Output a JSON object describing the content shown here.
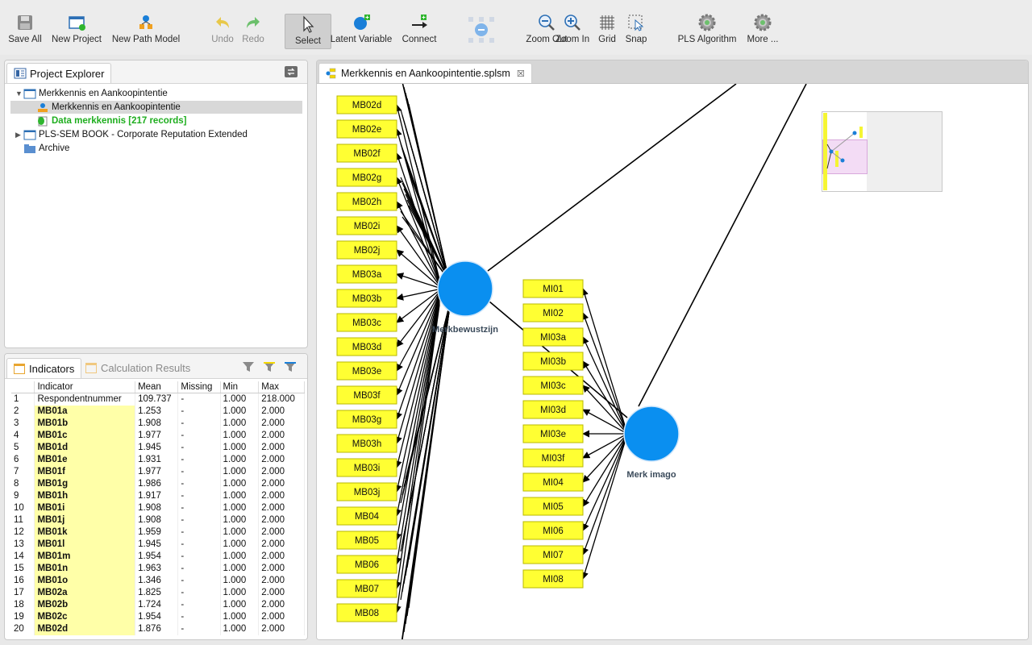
{
  "toolbar": [
    {
      "label": "Save All",
      "icon": "save-icon",
      "state": "normal"
    },
    {
      "label": "New Project",
      "icon": "new-project-icon",
      "state": "normal"
    },
    {
      "label": "New Path Model",
      "icon": "new-path-model-icon",
      "state": "normal"
    },
    {
      "label": "Undo",
      "icon": "undo-icon",
      "state": "disabled"
    },
    {
      "label": "Redo",
      "icon": "redo-icon",
      "state": "disabled"
    },
    {
      "label": "Select",
      "icon": "select-pointer-icon",
      "state": "active"
    },
    {
      "label": "Latent Variable",
      "icon": "latent-variable-icon",
      "state": "normal"
    },
    {
      "label": "Connect",
      "icon": "connect-arrow-icon",
      "state": "normal"
    },
    {
      "label": "Zoom Out",
      "icon": "zoom-out-icon",
      "state": "normal"
    },
    {
      "label": "Zoom In",
      "icon": "zoom-in-icon",
      "state": "normal"
    },
    {
      "label": "Grid",
      "icon": "grid-icon",
      "state": "normal"
    },
    {
      "label": "Snap",
      "icon": "snap-icon",
      "state": "normal"
    },
    {
      "label": "PLS Algorithm",
      "icon": "gear-icon",
      "state": "normal"
    },
    {
      "label": "More ...",
      "icon": "gear-icon",
      "state": "normal"
    }
  ],
  "explorer": {
    "title": "Project Explorer",
    "items": [
      {
        "label": "Merkkennis en Aankoopintentie",
        "level": 0,
        "expanded": true,
        "icon": "project-window-icon"
      },
      {
        "label": "Merkkennis en Aankoopintentie",
        "level": 1,
        "icon": "path-model-icon",
        "selected": true
      },
      {
        "label": "Data merkkennis [217 records]",
        "level": 1,
        "icon": "data-file-icon",
        "green": true
      },
      {
        "label": "PLS-SEM BOOK - Corporate Reputation Extended",
        "level": 0,
        "expanded": false,
        "icon": "project-window-icon"
      },
      {
        "label": "Archive",
        "level": 0,
        "icon": "archive-folder-icon"
      }
    ]
  },
  "indicators_panel": {
    "tabs": [
      "Indicators",
      "Calculation Results"
    ],
    "columns": [
      "",
      "Indicator",
      "Mean",
      "Missing",
      "Min",
      "Max"
    ],
    "rows": [
      [
        "1",
        "Respondentnummer",
        "109.737",
        "-",
        "1.000",
        "218.000"
      ],
      [
        "2",
        "MB01a",
        "1.253",
        "-",
        "1.000",
        "2.000"
      ],
      [
        "3",
        "MB01b",
        "1.908",
        "-",
        "1.000",
        "2.000"
      ],
      [
        "4",
        "MB01c",
        "1.977",
        "-",
        "1.000",
        "2.000"
      ],
      [
        "5",
        "MB01d",
        "1.945",
        "-",
        "1.000",
        "2.000"
      ],
      [
        "6",
        "MB01e",
        "1.931",
        "-",
        "1.000",
        "2.000"
      ],
      [
        "7",
        "MB01f",
        "1.977",
        "-",
        "1.000",
        "2.000"
      ],
      [
        "8",
        "MB01g",
        "1.986",
        "-",
        "1.000",
        "2.000"
      ],
      [
        "9",
        "MB01h",
        "1.917",
        "-",
        "1.000",
        "2.000"
      ],
      [
        "10",
        "MB01i",
        "1.908",
        "-",
        "1.000",
        "2.000"
      ],
      [
        "11",
        "MB01j",
        "1.908",
        "-",
        "1.000",
        "2.000"
      ],
      [
        "12",
        "MB01k",
        "1.959",
        "-",
        "1.000",
        "2.000"
      ],
      [
        "13",
        "MB01l",
        "1.945",
        "-",
        "1.000",
        "2.000"
      ],
      [
        "14",
        "MB01m",
        "1.954",
        "-",
        "1.000",
        "2.000"
      ],
      [
        "15",
        "MB01n",
        "1.963",
        "-",
        "1.000",
        "2.000"
      ],
      [
        "16",
        "MB01o",
        "1.346",
        "-",
        "1.000",
        "2.000"
      ],
      [
        "17",
        "MB02a",
        "1.825",
        "-",
        "1.000",
        "2.000"
      ],
      [
        "18",
        "MB02b",
        "1.724",
        "-",
        "1.000",
        "2.000"
      ],
      [
        "19",
        "MB02c",
        "1.954",
        "-",
        "1.000",
        "2.000"
      ],
      [
        "20",
        "MB02d",
        "1.876",
        "-",
        "1.000",
        "2.000"
      ]
    ]
  },
  "editor": {
    "tab_title": "Merkkennis en Aankoopintentie.splsm",
    "latent_variables": [
      "Merkbewustzijn",
      "Merk imago"
    ],
    "mb_indicators": [
      "MB02d",
      "MB02e",
      "MB02f",
      "MB02g",
      "MB02h",
      "MB02i",
      "MB02j",
      "MB03a",
      "MB03b",
      "MB03c",
      "MB03d",
      "MB03e",
      "MB03f",
      "MB03g",
      "MB03h",
      "MB03i",
      "MB03j",
      "MB04",
      "MB05",
      "MB06",
      "MB07",
      "MB08"
    ],
    "mi_indicators": [
      "MI01",
      "MI02",
      "MI03a",
      "MI03b",
      "MI03c",
      "MI03d",
      "MI03e",
      "MI03f",
      "MI04",
      "MI05",
      "MI06",
      "MI07",
      "MI08"
    ],
    "colors": {
      "latent": "#0a8ff0",
      "indicator": "#ffff33"
    }
  }
}
